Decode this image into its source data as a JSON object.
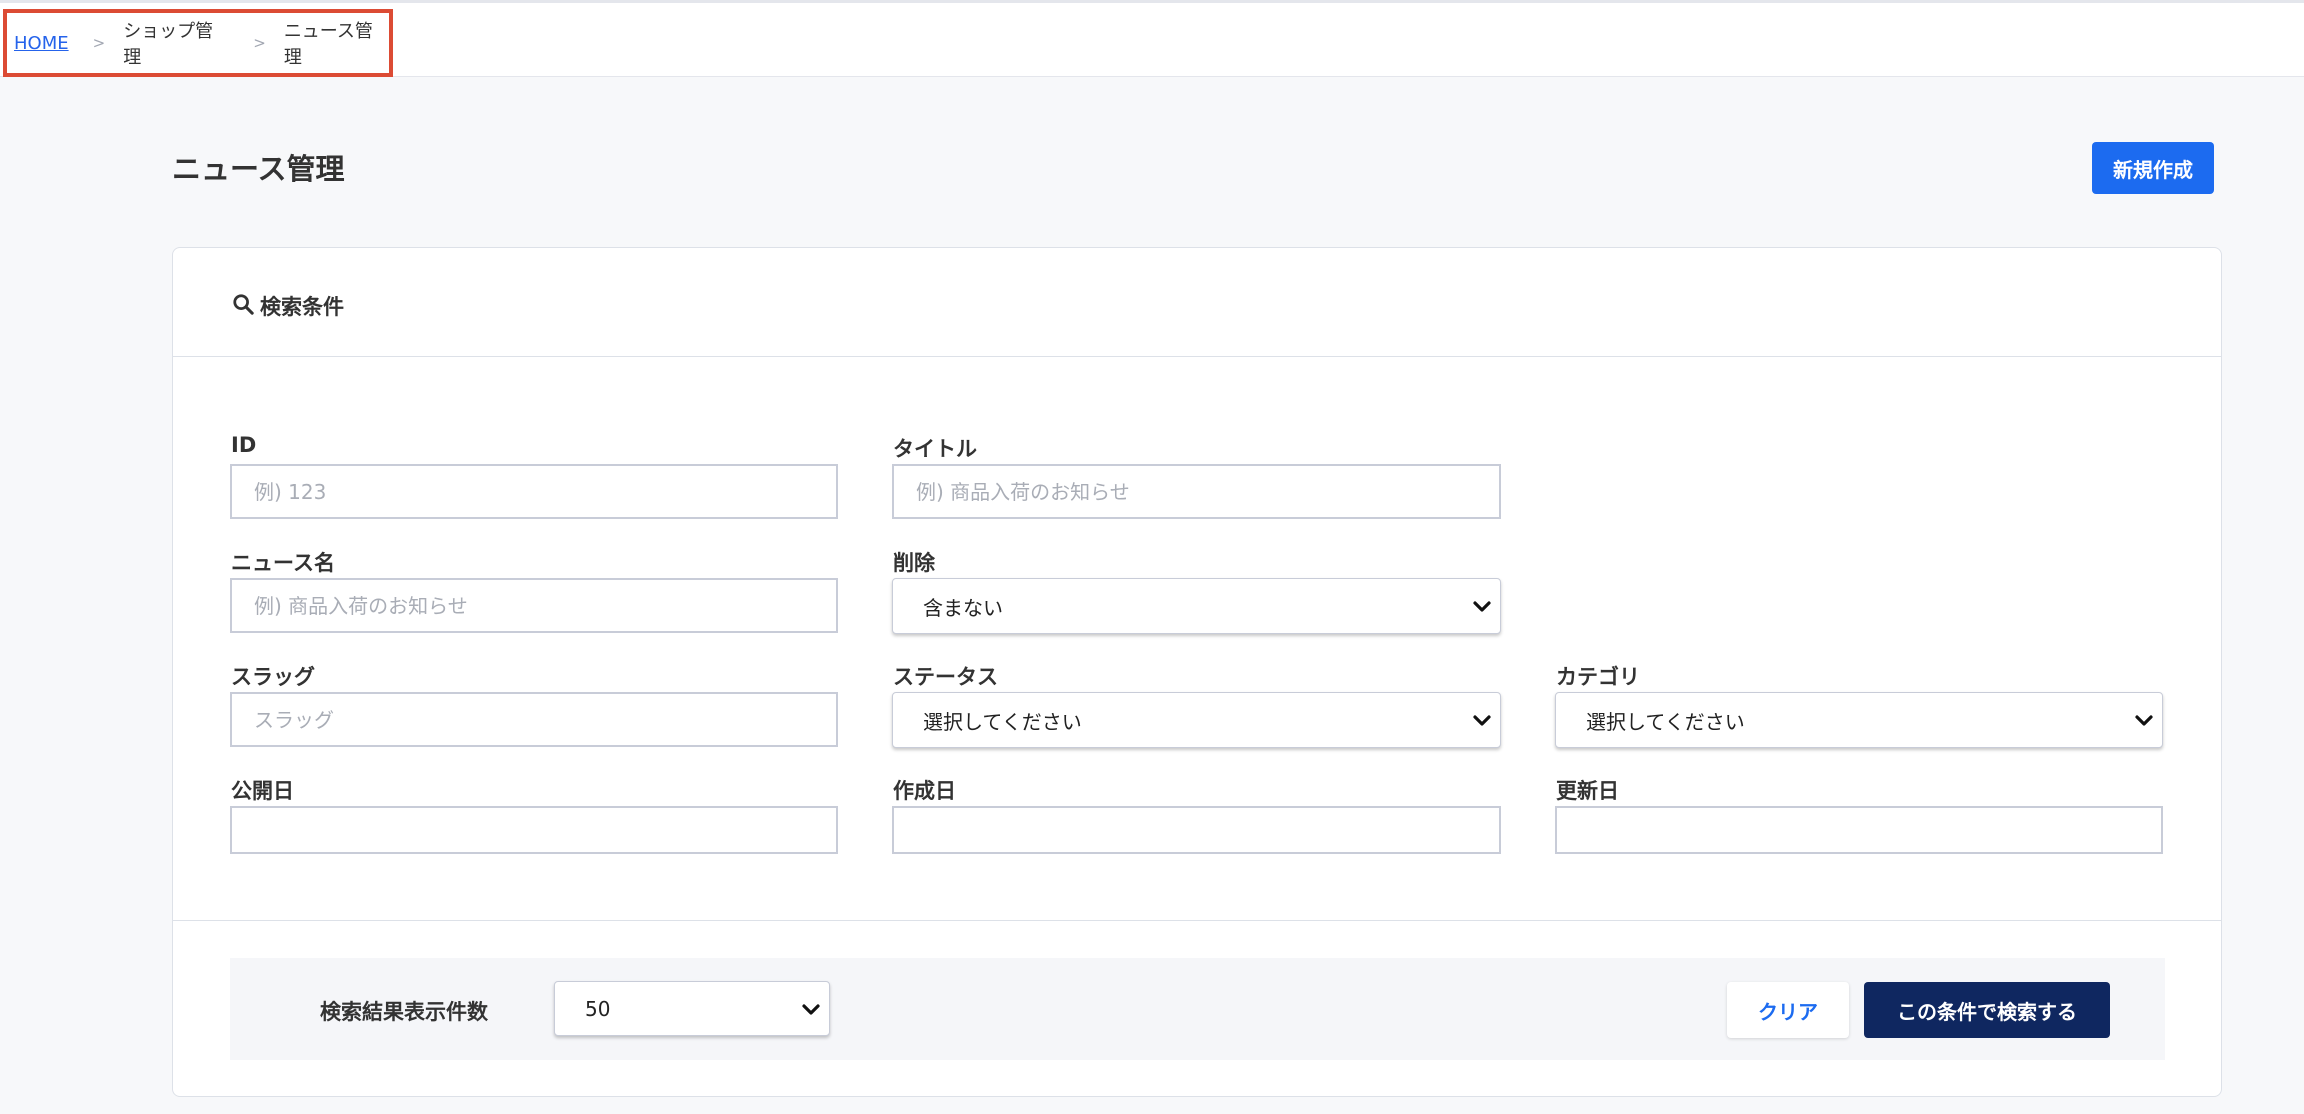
{
  "breadcrumb": {
    "home": "HOME",
    "items": [
      "ショップ管理",
      "ニュース管理"
    ],
    "separator": ">"
  },
  "page": {
    "title": "ニュース管理",
    "new_button": "新規作成"
  },
  "search": {
    "heading": "検索条件",
    "heading_icon": "search-icon",
    "fields": {
      "id": {
        "label": "ID",
        "placeholder": "例) 123",
        "value": ""
      },
      "title": {
        "label": "タイトル",
        "placeholder": "例) 商品入荷のお知らせ",
        "value": ""
      },
      "news_name": {
        "label": "ニュース名",
        "placeholder": "例) 商品入荷のお知らせ",
        "value": ""
      },
      "deleted": {
        "label": "削除",
        "selected": "含まない"
      },
      "slug": {
        "label": "スラッグ",
        "placeholder": "スラッグ",
        "value": ""
      },
      "status": {
        "label": "ステータス",
        "selected": "選択してください"
      },
      "category": {
        "label": "カテゴリ",
        "selected": "選択してください"
      },
      "published_date": {
        "label": "公開日",
        "value": ""
      },
      "created_date": {
        "label": "作成日",
        "value": ""
      },
      "updated_date": {
        "label": "更新日",
        "value": ""
      }
    },
    "per_page": {
      "label": "検索結果表示件数",
      "selected": "50"
    },
    "clear_button": "クリア",
    "submit_button": "この条件で検索する"
  },
  "colors": {
    "primary": "#1c6bf0",
    "navy": "#0f2760",
    "highlight_border": "#dc4b34"
  }
}
